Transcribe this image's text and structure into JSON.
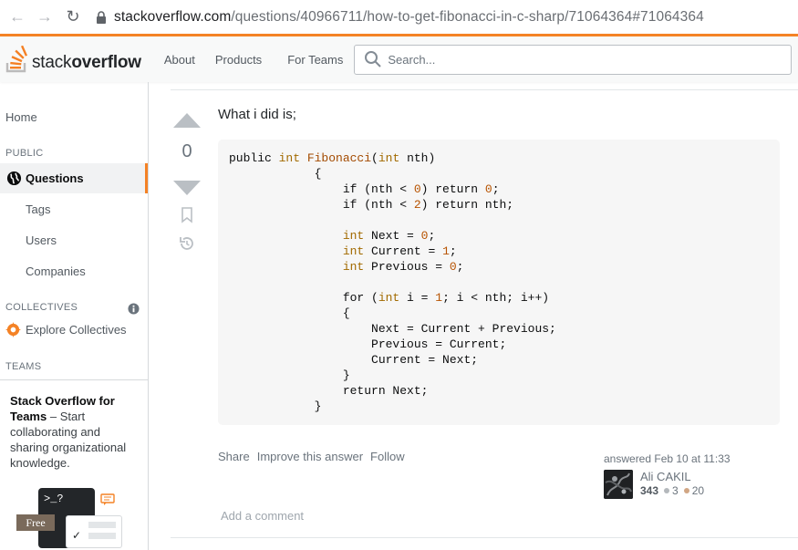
{
  "browser": {
    "url_host": "stackoverflow.com",
    "url_path": "/questions/40966711/how-to-get-fibonacci-in-c-sharp/71064364#71064364"
  },
  "topbar": {
    "logo_light": "stack",
    "logo_bold": "overflow",
    "links": [
      "About",
      "Products",
      "For Teams"
    ],
    "search_placeholder": "Search..."
  },
  "sidebar": {
    "home": "Home",
    "public_heading": "PUBLIC",
    "questions": "Questions",
    "tags": "Tags",
    "users": "Users",
    "companies": "Companies",
    "collectives_heading": "COLLECTIVES",
    "explore_collectives": "Explore Collectives",
    "teams_heading": "TEAMS",
    "teams_title": "Stack Overflow for Teams",
    "teams_dash": " – Start collaborating and sharing organizational knowledge.",
    "free_badge": "Free",
    "terminal_text": ">_?"
  },
  "answer": {
    "vote_count": "0",
    "intro": "What i did is;",
    "code_lines": [
      "public int Fibonacci(int nth)",
      "            {",
      "                if (nth < 0) return 0;",
      "                if (nth < 2) return nth;",
      "",
      "                int Next = 0;",
      "                int Current = 1;",
      "                int Previous = 0;",
      "",
      "                for (int i = 1; i < nth; i++)",
      "                {",
      "                    Next = Current + Previous;",
      "                    Previous = Current;",
      "                    Current = Next;",
      "                }",
      "                return Next;",
      "            }"
    ],
    "menu": [
      "Share",
      "Improve this answer",
      "Follow"
    ],
    "answered": "answered Feb 10 at 11:33",
    "user_name": "Ali CAKIL",
    "reputation": "343",
    "silver_badges": "3",
    "bronze_badges": "20",
    "add_comment": "Add a comment"
  },
  "colors": {
    "accent": "#f48225",
    "link_gray": "#6a737c"
  }
}
